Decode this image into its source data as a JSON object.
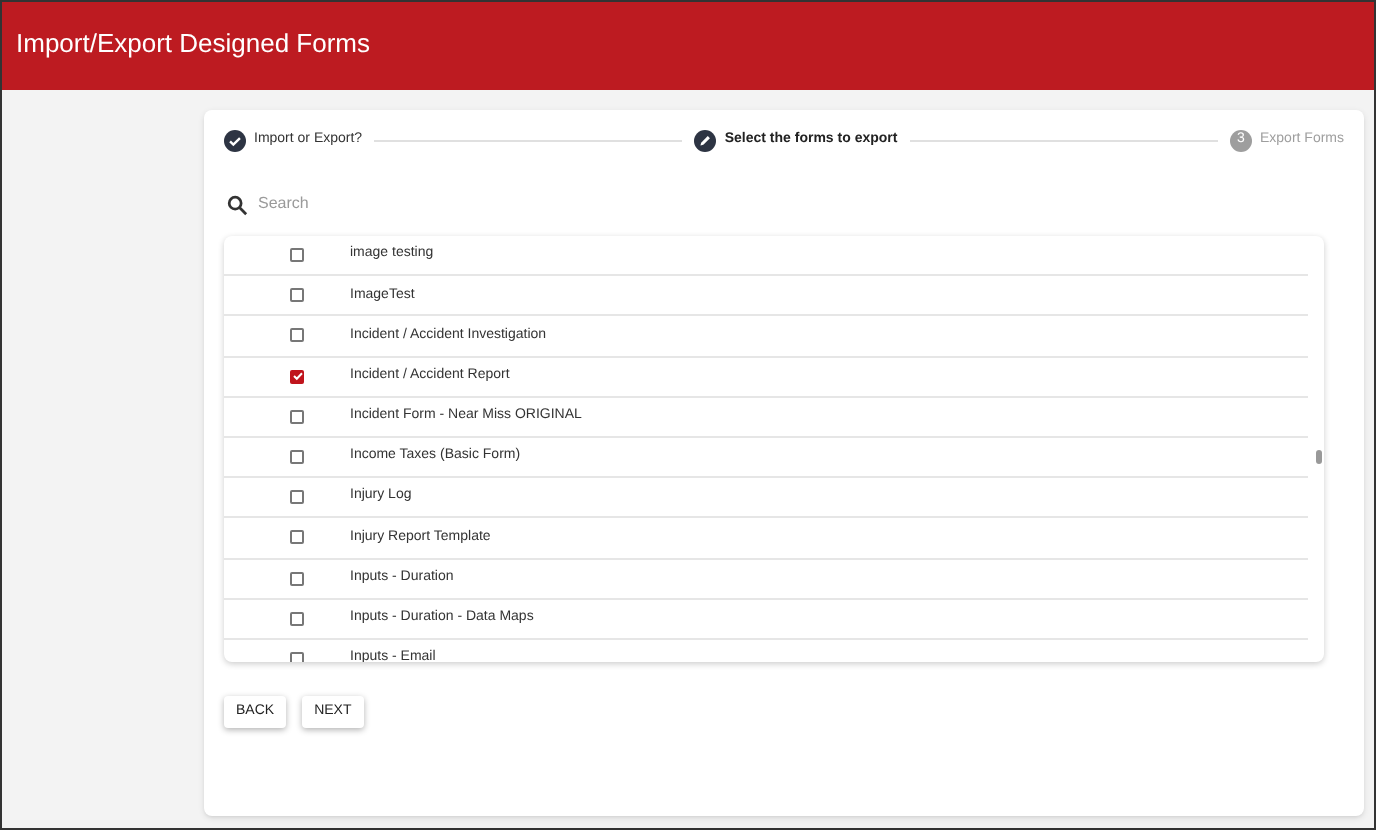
{
  "header": {
    "title": "Import/Export Designed Forms"
  },
  "steps": [
    {
      "label": "Import or Export?",
      "completed": true,
      "active": false
    },
    {
      "label": "Select the forms to export",
      "completed": false,
      "active": true
    },
    {
      "label": "Export Forms",
      "completed": false,
      "active": false,
      "number": "3"
    }
  ],
  "search": {
    "placeholder": "Search"
  },
  "forms": [
    {
      "name": "image testing",
      "checked": false
    },
    {
      "name": "ImageTest",
      "checked": false
    },
    {
      "name": "Incident / Accident Investigation",
      "checked": false
    },
    {
      "name": "Incident / Accident Report",
      "checked": true
    },
    {
      "name": "Incident Form - Near Miss ORIGINAL",
      "checked": false
    },
    {
      "name": "Income Taxes (Basic Form)",
      "checked": false
    },
    {
      "name": "Injury Log",
      "checked": false
    },
    {
      "name": "Injury Report Template",
      "checked": false
    },
    {
      "name": "Inputs - Duration",
      "checked": false
    },
    {
      "name": "Inputs - Duration - Data Maps",
      "checked": false
    },
    {
      "name": "Inputs - Email",
      "checked": false
    }
  ],
  "buttons": [
    "BACK",
    "NEXT"
  ]
}
